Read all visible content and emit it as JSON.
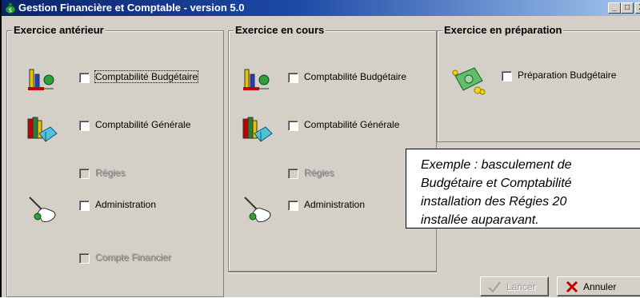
{
  "window": {
    "title": "Gestion Financière et Comptable - version 5.0",
    "controls": {
      "minimize": "_",
      "maximize": "□",
      "close": "X"
    }
  },
  "groups": [
    {
      "label": "Exercice antérieur",
      "items": [
        {
          "label": "Comptabilité Budgétaire",
          "icon": "budget-scale-icon",
          "enabled": true,
          "checked": false,
          "focused": true
        },
        {
          "label": "Comptabilité Générale",
          "icon": "books-icon",
          "enabled": true,
          "checked": false
        },
        {
          "label": "Régies",
          "icon": "",
          "enabled": false,
          "checked": false
        },
        {
          "label": "Administration",
          "icon": "hand-pointer-icon",
          "enabled": true,
          "checked": false
        },
        {
          "label": "Compte Financier",
          "icon": "",
          "enabled": false,
          "checked": false
        }
      ]
    },
    {
      "label": "Exercice en cours",
      "items": [
        {
          "label": "Comptabilité Budgétaire",
          "icon": "budget-scale-icon",
          "enabled": true,
          "checked": false
        },
        {
          "label": "Comptabilité Générale",
          "icon": "books-icon",
          "enabled": true,
          "checked": false
        },
        {
          "label": "Régies",
          "icon": "",
          "enabled": false,
          "checked": false
        },
        {
          "label": "Administration",
          "icon": "hand-pointer-icon",
          "enabled": true,
          "checked": false
        }
      ]
    },
    {
      "label": "Exercice en préparation",
      "items": [
        {
          "label": "Préparation Budgétaire",
          "icon": "money-icon",
          "enabled": true,
          "checked": false
        }
      ]
    }
  ],
  "buttons": {
    "lancer": {
      "label": "Lancer",
      "enabled": false
    },
    "annuler": {
      "label": "Annuler",
      "enabled": true
    }
  },
  "callout": {
    "text": "Exemple : basculement de\nBudgétaire et Comptabilité\ninstallation des Régies 20\ninstallée auparavant."
  },
  "colors": {
    "titlebar_start": "#0a246a",
    "titlebar_end": "#a6caf0",
    "face": "#d4d0c8",
    "cancel_x": "#c00000"
  }
}
